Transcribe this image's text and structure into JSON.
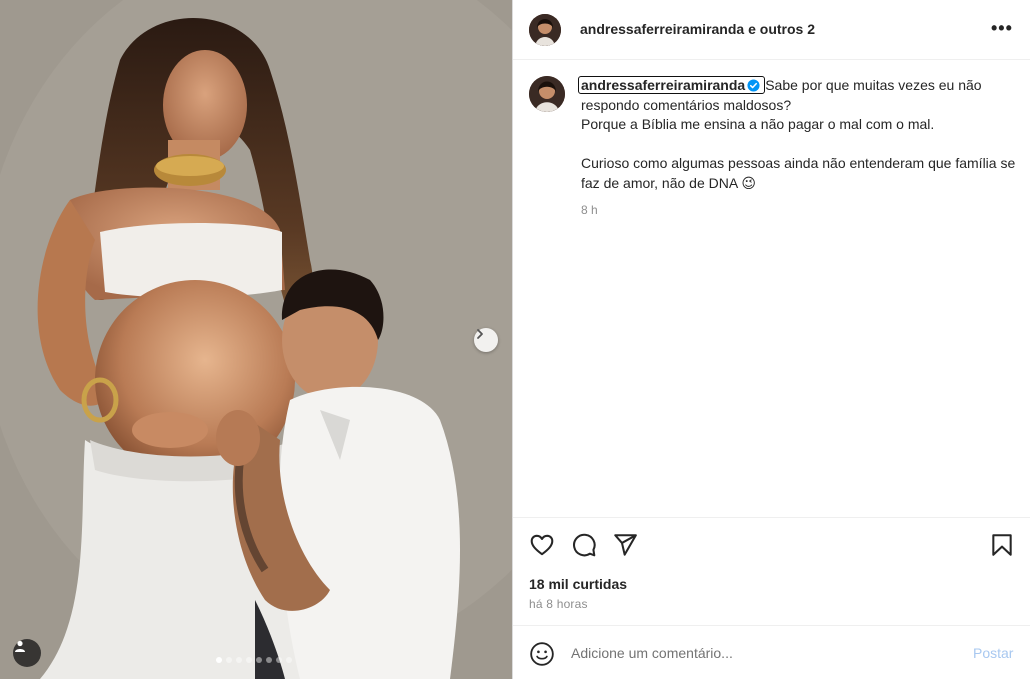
{
  "header": {
    "username": "andressaferreiramiranda",
    "others": "e outros 2",
    "more_label": "•••"
  },
  "caption": {
    "username": "andressaferreiramiranda",
    "line1": "Sabe por que muitas vezes eu não respondo comentários maldosos?",
    "line2": "Porque a Bíblia me ensina a não pagar o mal com o mal.",
    "line3": "Curioso como algumas pessoas ainda não entenderam que família se faz de amor, não de DNA 😉",
    "time": "8 h"
  },
  "stats": {
    "likes": "18 mil curtidas",
    "ago": "há 8 horas"
  },
  "comment": {
    "placeholder": "Adicione um comentário...",
    "post_label": "Postar"
  },
  "carousel": {
    "total_slides": 8,
    "active_slide": 1
  },
  "icons": {
    "like": "heart-icon",
    "comment": "comment-icon",
    "share": "share-icon",
    "save": "bookmark-icon",
    "emoji": "emoji-icon",
    "next": "chevron-right-icon",
    "tag": "user-tag-icon",
    "verified": "verified-badge-icon"
  },
  "colors": {
    "verified": "#0095f6",
    "post_disabled": "#a8c8f0",
    "muted": "#8e8e8e"
  }
}
